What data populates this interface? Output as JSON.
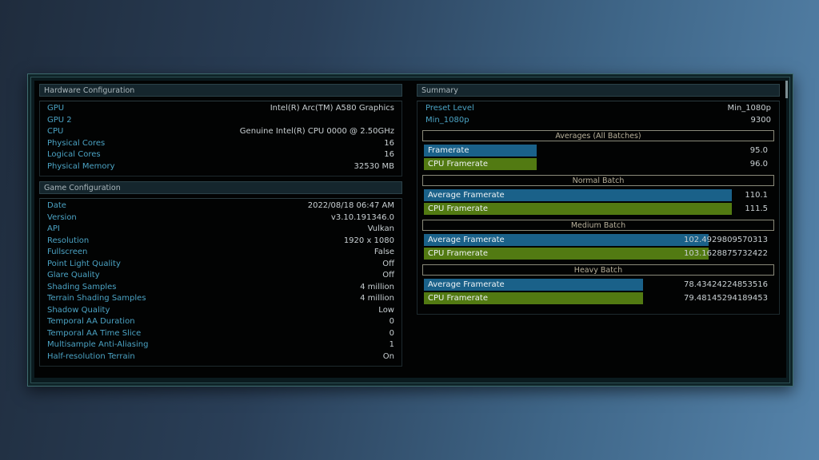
{
  "hardware": {
    "title": "Hardware Configuration",
    "rows": [
      {
        "key": "GPU",
        "value": "Intel(R) Arc(TM) A580 Graphics"
      },
      {
        "key": "GPU 2",
        "value": ""
      },
      {
        "key": "CPU",
        "value": "Genuine Intel(R) CPU 0000 @ 2.50GHz"
      },
      {
        "key": "Physical Cores",
        "value": "16"
      },
      {
        "key": "Logical Cores",
        "value": "16"
      },
      {
        "key": "Physical Memory",
        "value": "32530 MB"
      }
    ]
  },
  "game": {
    "title": "Game Configuration",
    "rows": [
      {
        "key": "Date",
        "value": "2022/08/18 06:47 AM"
      },
      {
        "key": "Version",
        "value": "v3.10.191346.0"
      },
      {
        "key": "API",
        "value": "Vulkan"
      },
      {
        "key": "Resolution",
        "value": "1920 x 1080"
      },
      {
        "key": "Fullscreen",
        "value": "False"
      },
      {
        "key": "Point Light Quality",
        "value": "Off"
      },
      {
        "key": "Glare Quality",
        "value": "Off"
      },
      {
        "key": "Shading Samples",
        "value": "4 million"
      },
      {
        "key": "Terrain Shading Samples",
        "value": "4 million"
      },
      {
        "key": "Shadow Quality",
        "value": "Low"
      },
      {
        "key": "Temporal AA Duration",
        "value": "0"
      },
      {
        "key": "Temporal AA Time Slice",
        "value": "0"
      },
      {
        "key": "Multisample Anti-Aliasing",
        "value": "1"
      },
      {
        "key": "Half-resolution Terrain",
        "value": "On"
      }
    ]
  },
  "summary": {
    "title": "Summary",
    "rows": [
      {
        "key": "Preset Level",
        "value": "Min_1080p"
      },
      {
        "key": "Min_1080p",
        "value": "9300"
      }
    ],
    "colors": {
      "framerate_bar": "#1a6189",
      "cpu_bar": "#527a12"
    },
    "batches": [
      {
        "title": "Averages (All Batches)",
        "bars": [
          {
            "label": "Framerate",
            "value": "95.0",
            "fill": 0.366,
            "kind": "blue"
          },
          {
            "label": "CPU Framerate",
            "value": "96.0",
            "fill": 0.366,
            "kind": "green"
          }
        ]
      },
      {
        "title": "Normal Batch",
        "bars": [
          {
            "label": "Average Framerate",
            "value": "110.1",
            "fill": 1.0,
            "kind": "blue"
          },
          {
            "label": "CPU Framerate",
            "value": "111.5",
            "fill": 1.0,
            "kind": "green"
          }
        ]
      },
      {
        "title": "Medium Batch",
        "bars": [
          {
            "label": "Average Framerate",
            "value": "102.4929809570313",
            "fill": 0.925,
            "kind": "blue"
          },
          {
            "label": "CPU Framerate",
            "value": "103.1628875732422",
            "fill": 0.925,
            "kind": "green"
          }
        ]
      },
      {
        "title": "Heavy Batch",
        "bars": [
          {
            "label": "Average Framerate",
            "value": "78.43424224853516",
            "fill": 0.712,
            "kind": "blue"
          },
          {
            "label": "CPU Framerate",
            "value": "79.48145294189453",
            "fill": 0.712,
            "kind": "green"
          }
        ]
      }
    ]
  }
}
